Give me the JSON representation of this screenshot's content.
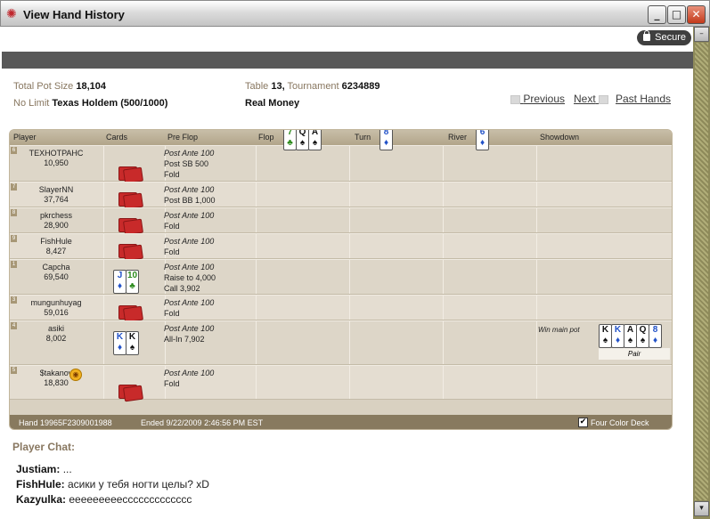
{
  "window": {
    "title": "View Hand History",
    "min": "_",
    "max": "□",
    "close": "✕"
  },
  "secure_label": "Secure",
  "info": {
    "total_pot_label": "Total Pot Size",
    "total_pot_value": "18,104",
    "game_prefix": "No Limit",
    "game_name": "Texas Holdem",
    "game_blinds": "(500/1000)",
    "table_label": "Table",
    "table_value": "13,",
    "tournament_label": "Tournament",
    "tournament_value": "6234889",
    "money": "Real Money"
  },
  "nav": {
    "previous": "Previous",
    "next": "Next",
    "past_hands": "Past Hands"
  },
  "columns": {
    "player": "Player",
    "cards": "Cards",
    "preflop": "Pre Flop",
    "flop": "Flop",
    "turn": "Turn",
    "river": "River",
    "showdown": "Showdown"
  },
  "board": {
    "flop": [
      {
        "rank": "7",
        "suit": "♣",
        "color": "c"
      },
      {
        "rank": "Q",
        "suit": "♠",
        "color": "s"
      },
      {
        "rank": "A",
        "suit": "♠",
        "color": "s"
      }
    ],
    "turn": [
      {
        "rank": "8",
        "suit": "♦",
        "color": "d"
      }
    ],
    "river": [
      {
        "rank": "6",
        "suit": "♦",
        "color": "d"
      }
    ]
  },
  "players": [
    {
      "seat": "6",
      "name": "TEXHOTPAHC",
      "chips": "10,950",
      "actions": [
        "Post Ante 100",
        "Post SB 500",
        "Fold"
      ]
    },
    {
      "seat": "7",
      "name": "SlayerNN",
      "chips": "37,764",
      "actions": [
        "Post Ante 100",
        "Post BB 1,000",
        "Fold"
      ]
    },
    {
      "seat": "8",
      "name": "pkrchess",
      "chips": "28,900",
      "actions": [
        "Post Ante 100",
        "Fold"
      ]
    },
    {
      "seat": "9",
      "name": "FishHule",
      "chips": "8,427",
      "actions": [
        "Post Ante 100",
        "Fold"
      ]
    },
    {
      "seat": "1",
      "name": "Capcha",
      "chips": "69,540",
      "actions": [
        "Post Ante 100",
        "Raise to 4,000",
        "Call 3,902"
      ],
      "cards": [
        {
          "rank": "J",
          "suit": "♦",
          "color": "d"
        },
        {
          "rank": "10",
          "suit": "♣",
          "color": "c"
        }
      ]
    },
    {
      "seat": "3",
      "name": "mungunhuyag",
      "chips": "59,016",
      "actions": [
        "Post Ante 100",
        "Fold"
      ]
    },
    {
      "seat": "4",
      "name": "asiki",
      "chips": "8,002",
      "actions": [
        "Post Ante 100",
        "All-In 7,902"
      ],
      "cards": [
        {
          "rank": "K",
          "suit": "♦",
          "color": "d"
        },
        {
          "rank": "K",
          "suit": "♠",
          "color": "s"
        }
      ],
      "showdown_text": "Win main pot",
      "showdown_hand": "Pair",
      "showdown_cards": [
        {
          "rank": "K",
          "suit": "♠",
          "color": "s"
        },
        {
          "rank": "K",
          "suit": "♦",
          "color": "d"
        },
        {
          "rank": "A",
          "suit": "♠",
          "color": "s"
        },
        {
          "rank": "Q",
          "suit": "♠",
          "color": "s"
        },
        {
          "rank": "8",
          "suit": "♦",
          "color": "d"
        }
      ]
    },
    {
      "seat": "5",
      "name": "$takanov",
      "chips": "18,830",
      "actions": [
        "Post Ante 100",
        "Fold"
      ]
    }
  ],
  "footer": {
    "hand": "Hand 19965F2309001988",
    "ended": "Ended 9/22/2009 2:46:56 PM EST",
    "four_color": "Four Color Deck",
    "checkmark": "✔"
  },
  "chat": {
    "title": "Player Chat:",
    "lines": [
      {
        "user": "Justiam:",
        "msg": " ..."
      },
      {
        "user": "FishHule:",
        "msg": " асики у тебя ногти целы? xD"
      },
      {
        "user": "Kazyulka:",
        "msg": " eeeeeeeeeccccccccccccc"
      }
    ]
  }
}
